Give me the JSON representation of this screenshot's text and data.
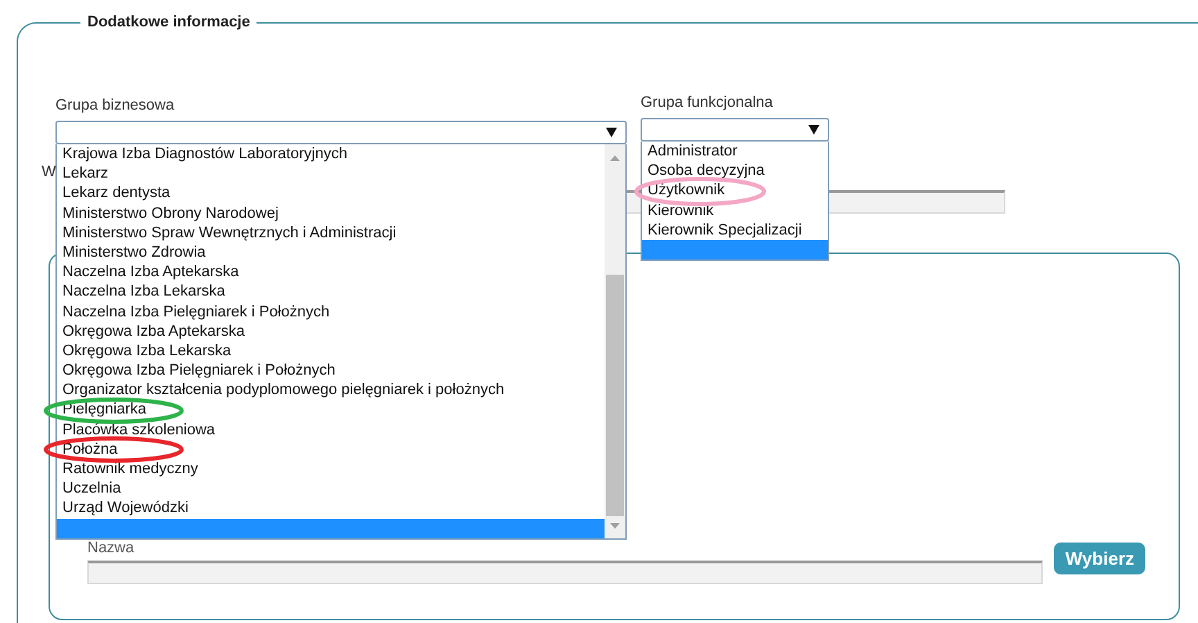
{
  "section": {
    "legend": "Dodatkowe informacje"
  },
  "business_group": {
    "label": "Grupa biznesowa",
    "open": true,
    "options": [
      {
        "label": "Krajowa Izba Diagnostów Laboratoryjnych",
        "selected": false
      },
      {
        "label": "Lekarz",
        "selected": false
      },
      {
        "label": "Lekarz dentysta",
        "selected": false
      },
      {
        "label": "Ministerstwo Obrony Narodowej",
        "selected": false
      },
      {
        "label": "Ministerstwo Spraw Wewnętrznych i Administracji",
        "selected": false
      },
      {
        "label": "Ministerstwo Zdrowia",
        "selected": false
      },
      {
        "label": "Naczelna Izba Aptekarska",
        "selected": false
      },
      {
        "label": "Naczelna Izba Lekarska",
        "selected": false
      },
      {
        "label": "Naczelna Izba Pielęgniarek i Położnych",
        "selected": false
      },
      {
        "label": "Okręgowa Izba Aptekarska",
        "selected": false
      },
      {
        "label": "Okręgowa Izba Lekarska",
        "selected": false
      },
      {
        "label": "Okręgowa Izba Pielęgniarek i Położnych",
        "selected": false
      },
      {
        "label": "Organizator kształcenia podyplomowego pielęgniarek i położnych",
        "selected": false
      },
      {
        "label": "Pielęgniarka",
        "selected": false,
        "color": "#2db34a"
      },
      {
        "label": "Placówka szkoleniowa",
        "selected": false
      },
      {
        "label": "Położna",
        "selected": false,
        "color": "#e8262b"
      },
      {
        "label": "Ratownik medyczny",
        "selected": false
      },
      {
        "label": "Uczelnia",
        "selected": false
      },
      {
        "label": "Urząd Wojewódzki",
        "selected": false
      },
      {
        "selected": true
      }
    ]
  },
  "functional_group": {
    "label": "Grupa funkcjonalna",
    "open": true,
    "options": [
      {
        "label": "Administrator",
        "selected": false
      },
      {
        "label": "Osoba decyzyjna",
        "selected": false
      },
      {
        "label": "Użytkownik",
        "selected": false,
        "color": "#f4a7c4"
      },
      {
        "label": "Kierownik",
        "selected": false
      },
      {
        "label": "Kierownik Specjalizacji",
        "selected": false
      },
      {
        "selected": true
      }
    ]
  },
  "hidden_field": {
    "label": "W",
    "disabled": true
  },
  "name_field": {
    "label": "Nazwa",
    "disabled": true
  },
  "select_button": "Wybierz"
}
